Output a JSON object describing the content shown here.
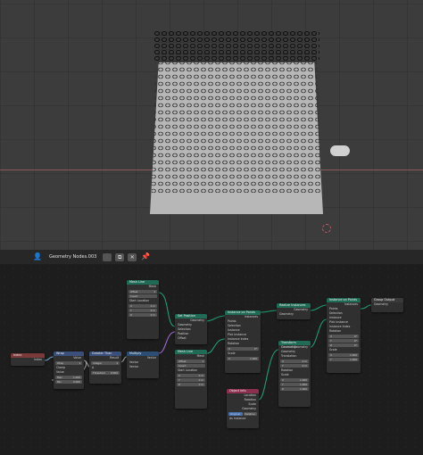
{
  "header": {
    "tree_name": "Geometry Nodes.003",
    "user_icon": "user-icon",
    "fake_user_icon": "shield-icon",
    "duplicate_icon": "duplicate-icon",
    "close_icon": "close-icon",
    "pin_icon": "pin-icon",
    "duplicate_glyph": "⧉",
    "close_glyph": "✕",
    "pin_glyph": "📌",
    "user_glyph": "👤"
  },
  "nodes": {
    "index": {
      "title": "Index",
      "out": "Index"
    },
    "wrap": {
      "title": "Wrap",
      "out": "Value",
      "mode": "Wrap",
      "rows": [
        "Clamp",
        "Value",
        "Max",
        "Min"
      ],
      "vals": [
        "",
        "",
        "1.000",
        "0.000"
      ]
    },
    "greater": {
      "title": "Greater Than",
      "out": "Result",
      "mode": "Integer",
      "rows": [
        "A",
        "B"
      ],
      "vals": [
        "",
        "0.000"
      ],
      "extra": "Threshold",
      "extra_val": "0.000"
    },
    "multiply": {
      "title": "Multiply",
      "out": "Vector",
      "mode": "Multiply",
      "rows": [
        "Vector",
        "Vector"
      ]
    },
    "mesh_line_top": {
      "title": "Mesh Line",
      "out": "Mesh",
      "rows": [
        "Offset",
        "Count",
        "Start Location"
      ],
      "vals": [
        "",
        "",
        ""
      ],
      "xyz": [
        "0 m",
        "0 m",
        "0 m"
      ]
    },
    "mesh_line_bottom": {
      "title": "Mesh Line",
      "out": "Mesh",
      "rows": [
        "Offset",
        "Count",
        "Start Location"
      ],
      "xyz": [
        "0 m",
        "0 m",
        "0 m"
      ]
    },
    "set_position": {
      "title": "Set Position",
      "out": "Geometry",
      "rows": [
        "Geometry",
        "Selection",
        "Position",
        "Offset"
      ]
    },
    "instance_on_points": {
      "title": "Instance on Points",
      "out": "Instances",
      "rows": [
        "Points",
        "Selection",
        "Instance",
        "Pick Instance",
        "Instance Index",
        "Rotation",
        "Scale"
      ],
      "xyz": [
        "0°",
        "0°",
        "0°"
      ],
      "scale": [
        "1.000",
        "1.000",
        "1.000"
      ]
    },
    "realize": {
      "title": "Realize Instances",
      "out": "Geometry",
      "rows": [
        "Geometry"
      ]
    },
    "instance_on_points_2": {
      "title": "Instance on Points",
      "out": "Instances",
      "rows": [
        "Points",
        "Selection",
        "Instance",
        "Pick Instance",
        "Instance Index",
        "Rotation",
        "Scale"
      ],
      "xyz": [
        "0°",
        "0°",
        "0°"
      ],
      "scale": [
        "1.000",
        "1.000",
        "1.000"
      ]
    },
    "transform": {
      "title": "Transform Geometry",
      "out": "Geometry",
      "rows": [
        "Geometry",
        "Translation",
        "Rotation",
        "Scale"
      ],
      "xyz": [
        "0 m",
        "0 m",
        "0 m"
      ],
      "scale": [
        "1.000",
        "1.000",
        "1.000"
      ]
    },
    "object_info": {
      "title": "Object Info",
      "rows": [
        "Location",
        "Rotation",
        "Scale",
        "Geometry"
      ],
      "mode_a": "Original",
      "mode_b": "Relative",
      "extra": "As Instance"
    },
    "group_output": {
      "title": "Group Output",
      "rows": [
        "Geometry"
      ]
    }
  }
}
